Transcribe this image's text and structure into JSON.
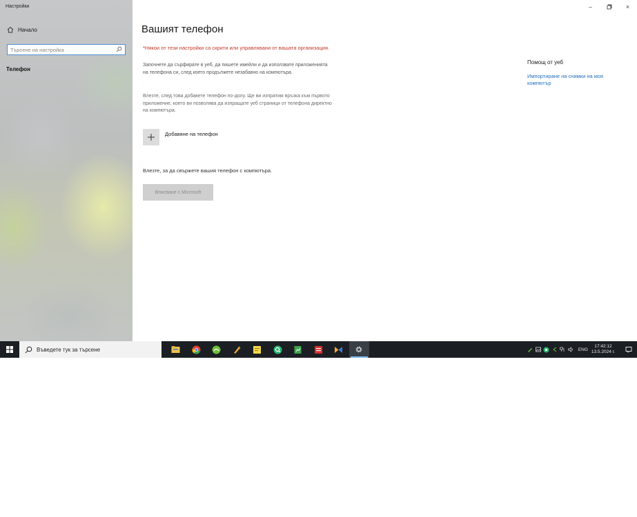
{
  "window": {
    "title": "Настройки",
    "minimize_glyph": "–",
    "maximize_glyph": "▫",
    "close_glyph": "×"
  },
  "sidebar": {
    "home_label": "Начало",
    "search_placeholder": "Търсене на настройка",
    "active_item": "Телефон"
  },
  "main": {
    "title": "Вашият телефон",
    "org_warning": "*Някои от тези настройки са скрити или управлявани от вашата организация.",
    "intro_paragraph": "Започнете да сърфирате в уеб, да пишете имейли и да използвате приложенията на телефона си, след което продължете незабавно на компютъра.",
    "link_paragraph": "Влезте, след това добавете телефон по-долу. Ще ви изпратим връзка към първото приложение, което ви позволява да изпращате уеб страници от телефона директно на компютъра.",
    "add_phone_label": "Добавяне на телефон",
    "signin_prompt": "Влезте, за да свържете вашия телефон с компютъра.",
    "signin_button": "Вписване с Microsoft"
  },
  "help": {
    "title": "Помощ от уеб",
    "link": "Импортиране на снимки на моя компютър"
  },
  "taskbar": {
    "search_label": "Въведете тук за търсене",
    "apps": [
      {
        "icon": "file-explorer-icon",
        "color": "#f0c14b"
      },
      {
        "icon": "chrome-icon",
        "color": "#e84335"
      },
      {
        "icon": "green-app-icon",
        "color": "#6fbf3a"
      },
      {
        "icon": "pen-app-icon",
        "color": "#e8a23a"
      },
      {
        "icon": "sticky-notes-icon",
        "color": "#f6d94a"
      },
      {
        "icon": "search-app-icon",
        "color": "#2bb673"
      },
      {
        "icon": "spreadsheet-icon",
        "color": "#3fa34d"
      },
      {
        "icon": "red-app-icon",
        "color": "#d8322e"
      },
      {
        "icon": "media-app-icon",
        "color": "#f2a93b"
      },
      {
        "icon": "settings-icon",
        "color": "#e8e8e8"
      }
    ],
    "language": "ENG",
    "time": "17:42:12",
    "date": "13.5.2024 г."
  },
  "colors": {
    "accent": "#1f6fbf",
    "warning": "#c0392b",
    "taskbar": "#1b1f24"
  }
}
